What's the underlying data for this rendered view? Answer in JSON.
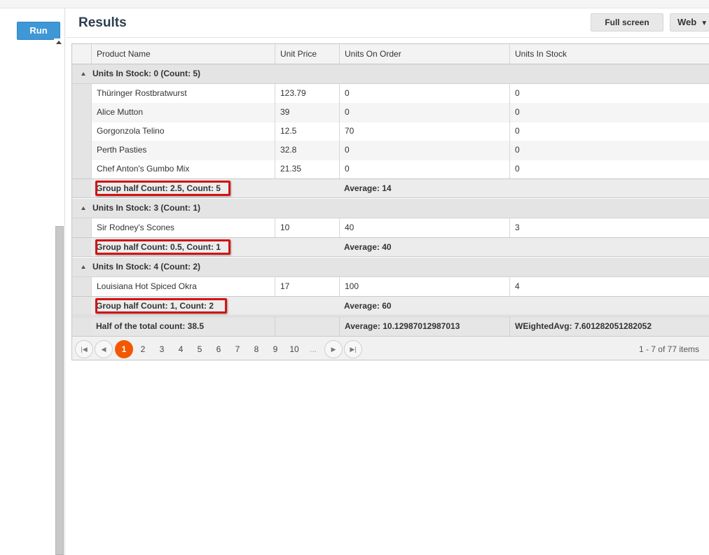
{
  "toolbar": {
    "run_label": "Run",
    "title": "Results",
    "fullscreen_label": "Full screen",
    "web_label": "Web"
  },
  "grid": {
    "columns": [
      "Product Name",
      "Unit Price",
      "Units On Order",
      "Units In Stock"
    ],
    "groups": [
      {
        "title": "Units In Stock: 0 (Count: 5)",
        "rows": [
          [
            "Thüringer Rostbratwurst",
            "123.79",
            "0",
            "0"
          ],
          [
            "Alice Mutton",
            "39",
            "0",
            "0"
          ],
          [
            "Gorgonzola Telino",
            "12.5",
            "70",
            "0"
          ],
          [
            "Perth Pasties",
            "32.8",
            "0",
            "0"
          ],
          [
            "Chef Anton's Gumbo Mix",
            "21.35",
            "0",
            "0"
          ]
        ],
        "footer_left": "Group half Count: 2.5, Count: 5",
        "footer_avg": "Average: 14"
      },
      {
        "title": "Units In Stock: 3 (Count: 1)",
        "rows": [
          [
            "Sir Rodney's Scones",
            "10",
            "40",
            "3"
          ]
        ],
        "footer_left": "Group half Count: 0.5, Count: 1",
        "footer_avg": "Average: 40"
      },
      {
        "title": "Units In Stock: 4 (Count: 2)",
        "rows": [
          [
            "Louisiana Hot Spiced Okra",
            "17",
            "100",
            "4"
          ]
        ],
        "footer_left": "Group half Count: 1, Count: 2",
        "footer_avg": "Average: 60"
      }
    ],
    "total": {
      "left": "Half of the total count: 38.5",
      "price": "",
      "avg": "Average: 10.12987012987013",
      "weighted": "WEightedAvg: 7.601282051282052"
    }
  },
  "pager": {
    "pages": [
      "1",
      "2",
      "3",
      "4",
      "5",
      "6",
      "7",
      "8",
      "9",
      "10",
      "..."
    ],
    "active": "1",
    "info": "1 - 7 of 77 items"
  },
  "colors": {
    "accent": "#3f97d6",
    "active_page": "#f35800",
    "highlight": "#d21414"
  }
}
